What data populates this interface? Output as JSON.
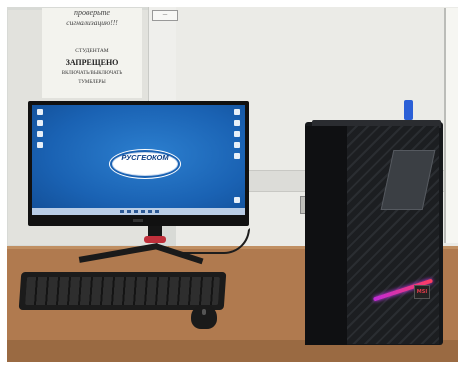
{
  "notice": {
    "line1": "проверьте",
    "line2": "сигнализацию!!!",
    "line3": "СТУДЕНТАМ",
    "line4": "ЗАПРЕЩЕНО",
    "line5": "ВКЛЮЧАТЬ/ВЫКЛЮЧАТЬ",
    "line6": "ТУМБЛЕРЫ"
  },
  "wall_label": "—",
  "screen": {
    "logo_text": "РУСГЕОКОМ"
  },
  "pc": {
    "badge": "MSI"
  },
  "colors": {
    "desktop_blue": "#1a62b3",
    "desk_wood": "#b07a4f",
    "stand_accent": "#c0303b",
    "rgb_strip": "#c02bd8"
  }
}
